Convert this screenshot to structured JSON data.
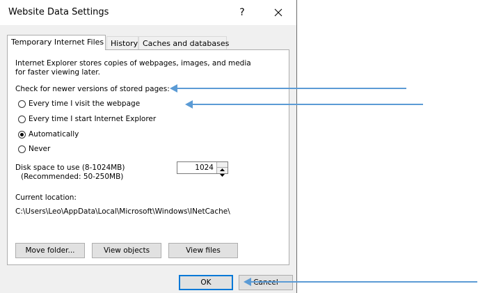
{
  "window": {
    "title": "Website Data Settings",
    "help_label": "?",
    "close_icon": "close-icon"
  },
  "tabs": [
    {
      "label": "Temporary Internet Files",
      "active": true
    },
    {
      "label": "History",
      "active": false
    },
    {
      "label": "Caches and databases",
      "active": false
    }
  ],
  "panel": {
    "description_line1": "Internet Explorer stores copies of webpages, images, and media",
    "description_line2": "for faster viewing later.",
    "check_heading": "Check for newer versions of stored pages:",
    "options": [
      {
        "label": "Every time I visit the webpage",
        "checked": false
      },
      {
        "label": "Every time I start Internet Explorer",
        "checked": false
      },
      {
        "label": "Automatically",
        "checked": true
      },
      {
        "label": "Never",
        "checked": false
      }
    ],
    "disk_space_label": "Disk space to use (8-1024MB)",
    "disk_space_recommended": "(Recommended: 50-250MB)",
    "disk_space_value": "1024",
    "current_location_label": "Current location:",
    "current_location_path": "C:\\Users\\Leo\\AppData\\Local\\Microsoft\\Windows\\INetCache\\",
    "buttons": {
      "move_folder": "Move folder...",
      "view_objects": "View objects",
      "view_files": "View files"
    }
  },
  "footer": {
    "ok_label": "OK",
    "cancel_label": "Cancel"
  },
  "annotation": {
    "arrow_color": "#5b9bd5"
  }
}
